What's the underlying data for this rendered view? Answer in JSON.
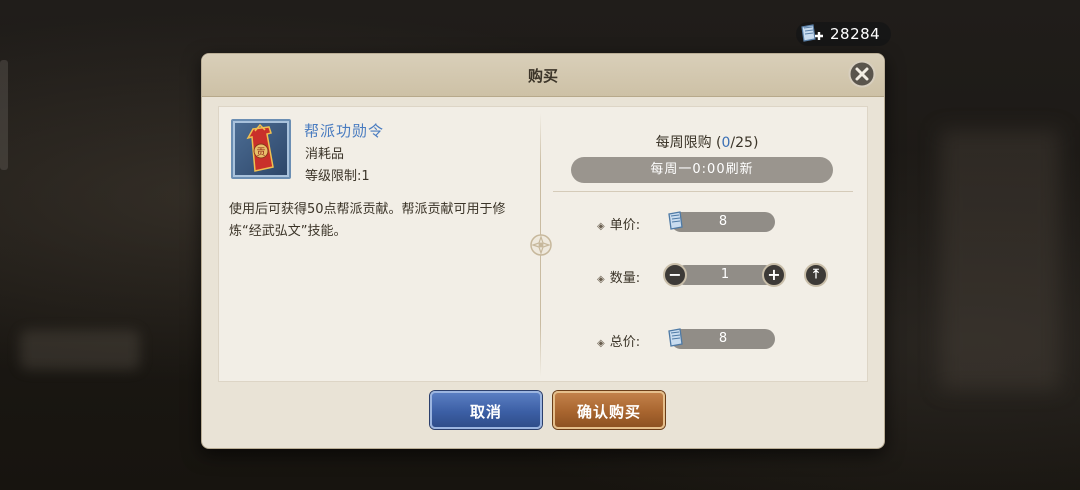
{
  "currency": {
    "value": "28284",
    "icon": "scroll-currency-plus-icon"
  },
  "dialog": {
    "title": "购买",
    "item": {
      "name": "帮派功勋令",
      "type": "消耗品",
      "level_limit": "等级限制:1",
      "description": "使用后可获得50点帮派贡献。帮派贡献可用于修炼“经武弘文”技能。",
      "icon": "red-token-icon"
    },
    "purchase": {
      "limit_prefix": "每周限购 (",
      "limit_current": "0",
      "limit_suffix": "/25)",
      "refresh_text": "每周一0:00刷新",
      "unit_price_label": "单价:",
      "unit_price": "8",
      "quantity_label": "数量:",
      "quantity": "1",
      "total_label": "总价:",
      "total": "8"
    },
    "buttons": {
      "cancel": "取消",
      "confirm": "确认购买"
    }
  },
  "colors": {
    "item_name": "#4a7cc0",
    "cancel_button": "#3c5fa5",
    "confirm_button": "#a8652f",
    "panel": "#e9e3d6"
  }
}
